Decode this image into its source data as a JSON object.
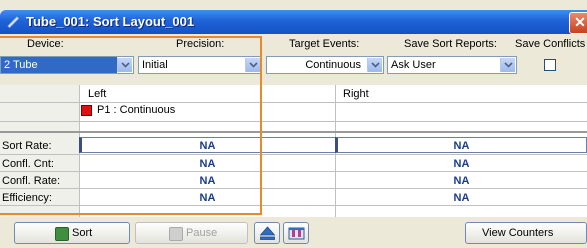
{
  "window": {
    "title": "Tube_001: Sort Layout_001"
  },
  "headers": {
    "device": "Device:",
    "precision": "Precision:",
    "target_events": "Target Events:",
    "save_sort_reports": "Save Sort Reports:",
    "save_conflicts": "Save Conflicts"
  },
  "controls": {
    "device": "2 Tube",
    "precision": "Initial",
    "target_events": "Continuous",
    "save_sort_reports": "Ask User",
    "save_conflicts_checked": false
  },
  "grid": {
    "columns": [
      "Left",
      "Right"
    ],
    "populations": [
      {
        "label": "P1 : Continuous",
        "color": "#e01010"
      }
    ],
    "rows": [
      {
        "label": "Sort Rate:",
        "left": "NA",
        "right": "NA"
      },
      {
        "label": "Confl. Cnt:",
        "left": "NA",
        "right": "NA"
      },
      {
        "label": "Confl. Rate:",
        "left": "NA",
        "right": "NA"
      },
      {
        "label": "Efficiency:",
        "left": "NA",
        "right": "NA"
      }
    ]
  },
  "toolbar": {
    "sort": "Sort",
    "pause": "Pause",
    "view_counters": "View Counters"
  }
}
